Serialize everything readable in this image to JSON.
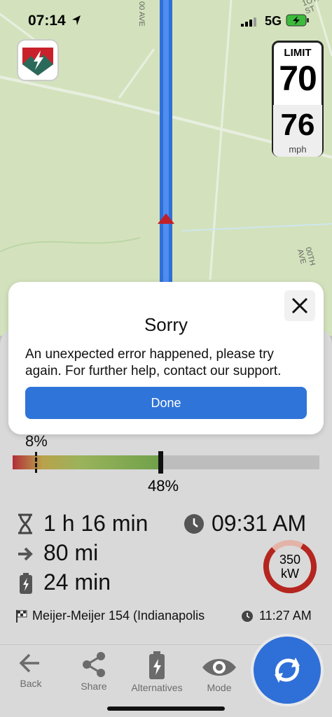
{
  "status_bar": {
    "time": "07:14",
    "network": "5G"
  },
  "map": {
    "road_label_top": "00 AVE",
    "road_label_right": "00TH AVE",
    "road_label_right2": "1OTH ST"
  },
  "speed_sign": {
    "limit_label": "LIMIT",
    "limit_value": "70",
    "current_speed": "76",
    "unit": "mph"
  },
  "route": {
    "battery_start": "8%",
    "battery_end": "48%",
    "battery_end_fraction": 0.48,
    "duration": "1 h 16 min",
    "arrival_time": "09:31 AM",
    "distance": "80 mi",
    "charge_time": "24 min",
    "charger_power": "350",
    "charger_unit": "kW",
    "station": "Meijer-Meijer 154 (Indianapolis",
    "station_time": "11:27 AM"
  },
  "nav": {
    "back": "Back",
    "share": "Share",
    "alternatives": "Alternatives",
    "mode": "Mode"
  },
  "dialog": {
    "title": "Sorry",
    "message": "An unexpected error happened, please try again. For further help, contact our support.",
    "done": "Done"
  },
  "colors": {
    "route": "#2f6fd8",
    "accent": "#2f74d8",
    "error_red": "#b22e38"
  }
}
